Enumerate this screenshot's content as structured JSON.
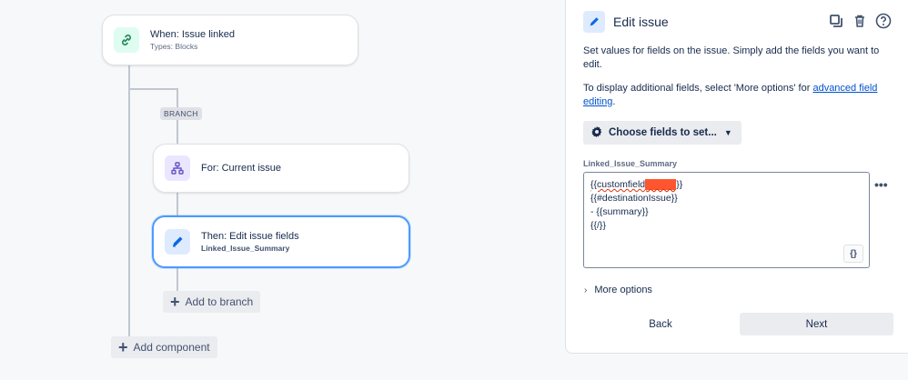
{
  "flow": {
    "trigger": {
      "title": "When: Issue linked",
      "subtitle": "Types: Blocks",
      "icon": "link-icon"
    },
    "branch_tag": "BRANCH",
    "branch": {
      "title": "For: Current issue",
      "icon": "hierarchy-icon"
    },
    "action": {
      "title": "Then: Edit issue fields",
      "subtitle": "Linked_Issue_Summary",
      "icon": "pencil-icon"
    },
    "add_to_branch": "Add to branch",
    "add_component": "Add component"
  },
  "panel": {
    "title": "Edit issue",
    "desc1": "Set values for fields on the issue. Simply add the fields you want to edit.",
    "desc2_prefix": "To display additional fields, select 'More options' for ",
    "desc2_link": "advanced field editing",
    "desc2_suffix": ".",
    "choose_fields": "Choose fields to set...",
    "field_label": "Linked_Issue_Summary",
    "field_lines": {
      "l1_prefix": "{{customfield",
      "l1_redacted": "_xxxxx",
      "l1_suffix": "}}",
      "l2": "{{#destinationIssue}}",
      "l3": "- {{summary}}",
      "l4": "{{/}}"
    },
    "smart_values_button": "{}",
    "more_options": "More options",
    "back": "Back",
    "next": "Next"
  },
  "colors": {
    "accent": "#4c9aff",
    "link": "#0052cc",
    "redaction": "#ff5630"
  }
}
